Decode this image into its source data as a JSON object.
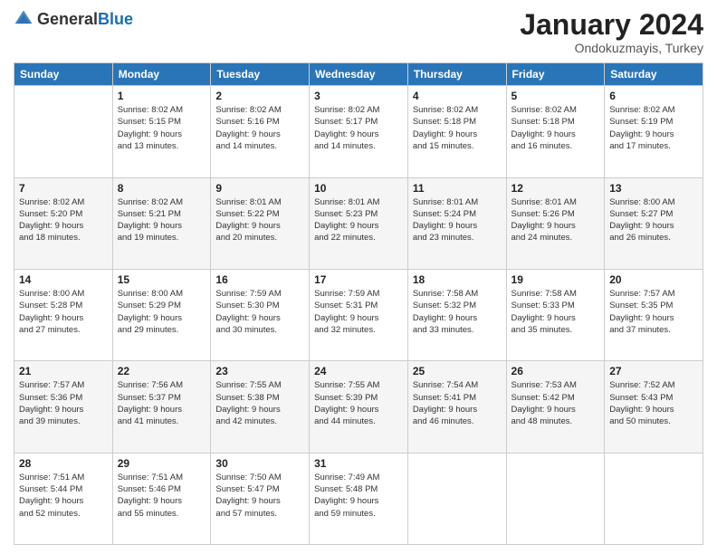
{
  "header": {
    "logo": {
      "general": "General",
      "blue": "Blue"
    },
    "title": "January 2024",
    "location": "Ondokuzmayis, Turkey"
  },
  "calendar": {
    "days_of_week": [
      "Sunday",
      "Monday",
      "Tuesday",
      "Wednesday",
      "Thursday",
      "Friday",
      "Saturday"
    ],
    "weeks": [
      [
        {
          "day": "",
          "info": ""
        },
        {
          "day": "1",
          "info": "Sunrise: 8:02 AM\nSunset: 5:15 PM\nDaylight: 9 hours\nand 13 minutes."
        },
        {
          "day": "2",
          "info": "Sunrise: 8:02 AM\nSunset: 5:16 PM\nDaylight: 9 hours\nand 14 minutes."
        },
        {
          "day": "3",
          "info": "Sunrise: 8:02 AM\nSunset: 5:17 PM\nDaylight: 9 hours\nand 14 minutes."
        },
        {
          "day": "4",
          "info": "Sunrise: 8:02 AM\nSunset: 5:18 PM\nDaylight: 9 hours\nand 15 minutes."
        },
        {
          "day": "5",
          "info": "Sunrise: 8:02 AM\nSunset: 5:18 PM\nDaylight: 9 hours\nand 16 minutes."
        },
        {
          "day": "6",
          "info": "Sunrise: 8:02 AM\nSunset: 5:19 PM\nDaylight: 9 hours\nand 17 minutes."
        }
      ],
      [
        {
          "day": "7",
          "info": "Sunrise: 8:02 AM\nSunset: 5:20 PM\nDaylight: 9 hours\nand 18 minutes."
        },
        {
          "day": "8",
          "info": "Sunrise: 8:02 AM\nSunset: 5:21 PM\nDaylight: 9 hours\nand 19 minutes."
        },
        {
          "day": "9",
          "info": "Sunrise: 8:01 AM\nSunset: 5:22 PM\nDaylight: 9 hours\nand 20 minutes."
        },
        {
          "day": "10",
          "info": "Sunrise: 8:01 AM\nSunset: 5:23 PM\nDaylight: 9 hours\nand 22 minutes."
        },
        {
          "day": "11",
          "info": "Sunrise: 8:01 AM\nSunset: 5:24 PM\nDaylight: 9 hours\nand 23 minutes."
        },
        {
          "day": "12",
          "info": "Sunrise: 8:01 AM\nSunset: 5:26 PM\nDaylight: 9 hours\nand 24 minutes."
        },
        {
          "day": "13",
          "info": "Sunrise: 8:00 AM\nSunset: 5:27 PM\nDaylight: 9 hours\nand 26 minutes."
        }
      ],
      [
        {
          "day": "14",
          "info": "Sunrise: 8:00 AM\nSunset: 5:28 PM\nDaylight: 9 hours\nand 27 minutes."
        },
        {
          "day": "15",
          "info": "Sunrise: 8:00 AM\nSunset: 5:29 PM\nDaylight: 9 hours\nand 29 minutes."
        },
        {
          "day": "16",
          "info": "Sunrise: 7:59 AM\nSunset: 5:30 PM\nDaylight: 9 hours\nand 30 minutes."
        },
        {
          "day": "17",
          "info": "Sunrise: 7:59 AM\nSunset: 5:31 PM\nDaylight: 9 hours\nand 32 minutes."
        },
        {
          "day": "18",
          "info": "Sunrise: 7:58 AM\nSunset: 5:32 PM\nDaylight: 9 hours\nand 33 minutes."
        },
        {
          "day": "19",
          "info": "Sunrise: 7:58 AM\nSunset: 5:33 PM\nDaylight: 9 hours\nand 35 minutes."
        },
        {
          "day": "20",
          "info": "Sunrise: 7:57 AM\nSunset: 5:35 PM\nDaylight: 9 hours\nand 37 minutes."
        }
      ],
      [
        {
          "day": "21",
          "info": "Sunrise: 7:57 AM\nSunset: 5:36 PM\nDaylight: 9 hours\nand 39 minutes."
        },
        {
          "day": "22",
          "info": "Sunrise: 7:56 AM\nSunset: 5:37 PM\nDaylight: 9 hours\nand 41 minutes."
        },
        {
          "day": "23",
          "info": "Sunrise: 7:55 AM\nSunset: 5:38 PM\nDaylight: 9 hours\nand 42 minutes."
        },
        {
          "day": "24",
          "info": "Sunrise: 7:55 AM\nSunset: 5:39 PM\nDaylight: 9 hours\nand 44 minutes."
        },
        {
          "day": "25",
          "info": "Sunrise: 7:54 AM\nSunset: 5:41 PM\nDaylight: 9 hours\nand 46 minutes."
        },
        {
          "day": "26",
          "info": "Sunrise: 7:53 AM\nSunset: 5:42 PM\nDaylight: 9 hours\nand 48 minutes."
        },
        {
          "day": "27",
          "info": "Sunrise: 7:52 AM\nSunset: 5:43 PM\nDaylight: 9 hours\nand 50 minutes."
        }
      ],
      [
        {
          "day": "28",
          "info": "Sunrise: 7:51 AM\nSunset: 5:44 PM\nDaylight: 9 hours\nand 52 minutes."
        },
        {
          "day": "29",
          "info": "Sunrise: 7:51 AM\nSunset: 5:46 PM\nDaylight: 9 hours\nand 55 minutes."
        },
        {
          "day": "30",
          "info": "Sunrise: 7:50 AM\nSunset: 5:47 PM\nDaylight: 9 hours\nand 57 minutes."
        },
        {
          "day": "31",
          "info": "Sunrise: 7:49 AM\nSunset: 5:48 PM\nDaylight: 9 hours\nand 59 minutes."
        },
        {
          "day": "",
          "info": ""
        },
        {
          "day": "",
          "info": ""
        },
        {
          "day": "",
          "info": ""
        }
      ]
    ]
  }
}
